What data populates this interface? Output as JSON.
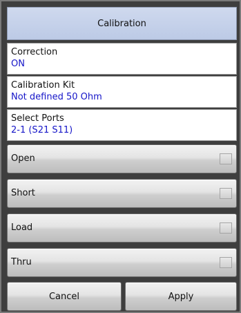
{
  "title": "Calibration",
  "fields": [
    {
      "label": "Correction",
      "value": "ON"
    },
    {
      "label": "Calibration Kit",
      "value": "Not defined 50 Ohm"
    },
    {
      "label": "Select Ports",
      "value": "2-1 (S21 S11)"
    }
  ],
  "standards": [
    {
      "label": "Open"
    },
    {
      "label": "Short"
    },
    {
      "label": "Load"
    },
    {
      "label": "Thru"
    }
  ],
  "footer": {
    "cancel_label": "Cancel",
    "apply_label": "Apply"
  },
  "colors": {
    "title_bg": "#c6d2ea",
    "value_text": "#1515c8",
    "panel_bg": "#3e3e3e"
  }
}
